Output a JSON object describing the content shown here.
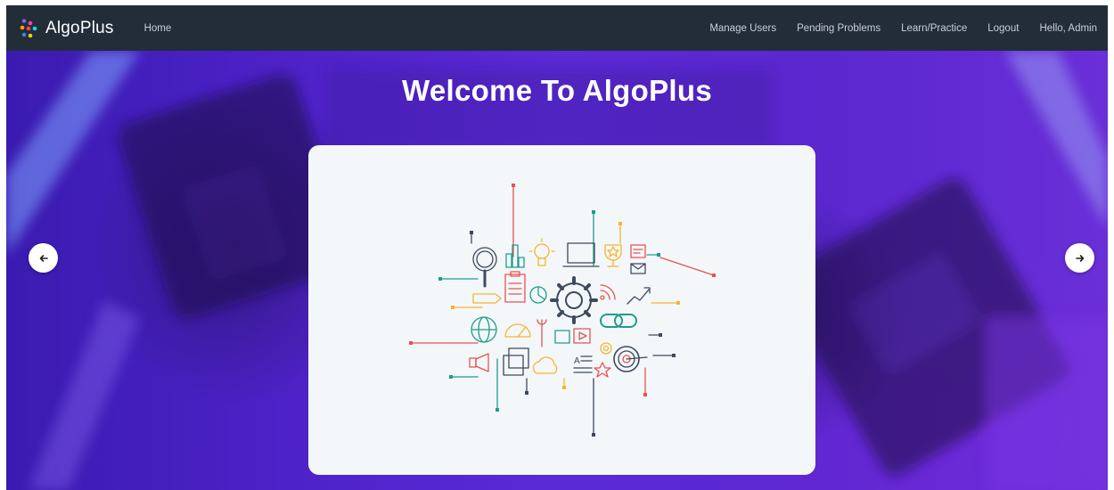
{
  "brand": {
    "name": "AlgoPlus",
    "logo_icon": "dots-logo-icon"
  },
  "nav": {
    "home": "Home",
    "right_items": [
      "Manage Users",
      "Pending Problems",
      "Learn/Practice",
      "Logout",
      "Hello, Admin"
    ]
  },
  "hero": {
    "title": "Welcome To AlgoPlus",
    "carousel": {
      "prev_icon": "arrow-left-icon",
      "next_icon": "arrow-right-icon",
      "slide_image": "technology-icons-illustration"
    }
  },
  "colors": {
    "navbar": "#232d38",
    "hero_purple": "#4d22c8",
    "card": "#f3f7fa",
    "icon_dark": "#3d4a5c",
    "icon_red": "#e8524e",
    "icon_yellow": "#f5b52e",
    "icon_teal": "#1e9c8c",
    "icon_gray": "#6b7787"
  }
}
